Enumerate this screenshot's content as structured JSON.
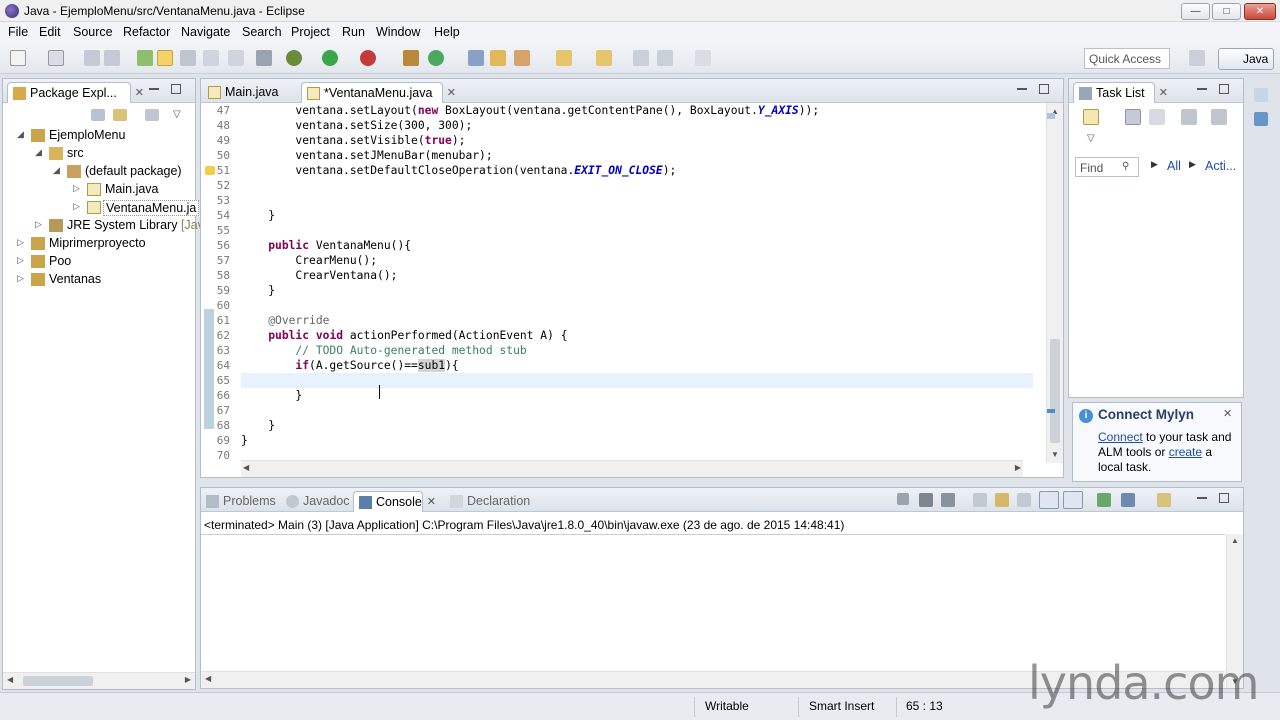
{
  "window": {
    "title": "Java - EjemploMenu/src/VentanaMenu.java - Eclipse",
    "buttons": {
      "min": "—",
      "max": "□",
      "close": "✕"
    }
  },
  "menubar": [
    "File",
    "Edit",
    "Source",
    "Refactor",
    "Navigate",
    "Search",
    "Project",
    "Run",
    "Window",
    "Help"
  ],
  "toolbar": {
    "quick_access": "Quick Access",
    "perspective": "Java"
  },
  "package_explorer": {
    "tab": "Package Expl...",
    "tree": [
      {
        "label": "EjemploMenu",
        "decoration": ""
      },
      {
        "label": "src",
        "decoration": ""
      },
      {
        "label": "(default package)",
        "decoration": ""
      },
      {
        "label": "Main.java",
        "decoration": ""
      },
      {
        "label": "VentanaMenu.ja",
        "decoration": ""
      },
      {
        "label": "JRE System Library",
        "decoration": "[Java"
      },
      {
        "label": "Miprimerproyecto",
        "decoration": ""
      },
      {
        "label": "Poo",
        "decoration": ""
      },
      {
        "label": "Ventanas",
        "decoration": ""
      }
    ]
  },
  "editor": {
    "tabs": [
      "Main.java",
      "*VentanaMenu.java"
    ],
    "line_numbers": [
      "47",
      "48",
      "49",
      "50",
      "51",
      "52",
      "53",
      "54",
      "55",
      "56",
      "57",
      "58",
      "59",
      "60",
      "61",
      "62",
      "63",
      "64",
      "65",
      "66",
      "67",
      "68",
      "69",
      "70"
    ],
    "lines": [
      "ventana.setLayout(new BoxLayout(ventana.getContentPane(), BoxLayout.Y_AXIS));",
      "ventana.setSize(300, 300);",
      "ventana.setVisible(true);",
      "ventana.setJMenuBar(menubar);",
      "ventana.setDefaultCloseOperation(ventana.EXIT_ON_CLOSE);",
      "",
      "",
      "}",
      "",
      "public VentanaMenu(){",
      "CrearMenu();",
      "CrearVentana();",
      "}",
      "",
      "@Override",
      "public void actionPerformed(ActionEvent A) {",
      "// TODO Auto-generated method stub",
      "if(A.getSource()==sub1){",
      "",
      "}",
      "",
      "}",
      "}",
      ""
    ]
  },
  "task_list": {
    "tab": "Task List",
    "find_placeholder": "Find",
    "filter_all": "All",
    "filter_acti": "Acti..."
  },
  "mylyn": {
    "title": "Connect Mylyn",
    "connect_link": "Connect",
    "text1": " to your task and",
    "text2": "ALM tools or ",
    "create_link": "create",
    "text3": " a",
    "text4": "local task."
  },
  "console": {
    "tabs": [
      "Problems",
      "Javadoc",
      "Console",
      "Declaration"
    ],
    "text": "<terminated> Main (3) [Java Application] C:\\Program Files\\Java\\jre1.8.0_40\\bin\\javaw.exe (23 de ago. de 2015 14:48:41)"
  },
  "status": {
    "writable": "Writable",
    "insert_mode": "Smart Insert",
    "position": "65 : 13"
  },
  "watermark": "lynda.com"
}
